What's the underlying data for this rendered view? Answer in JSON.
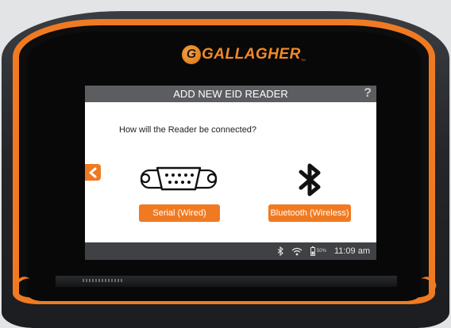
{
  "device": {
    "brand": "GALLAGHER",
    "brand_initial": "G",
    "brand_tm": "TM",
    "accent_color": "#f07a22"
  },
  "screen": {
    "title": "ADD NEW EID READER",
    "help_icon": "?",
    "question": "How will the Reader be connected?",
    "options": [
      {
        "label": "Serial (Wired)",
        "icon": "serial-port-icon"
      },
      {
        "label": "Bluetooth (Wireless)",
        "icon": "bluetooth-icon"
      }
    ],
    "back_icon": "chevron-left-icon"
  },
  "status_bar": {
    "battery_percent": "50%",
    "time": "11:09 am"
  }
}
